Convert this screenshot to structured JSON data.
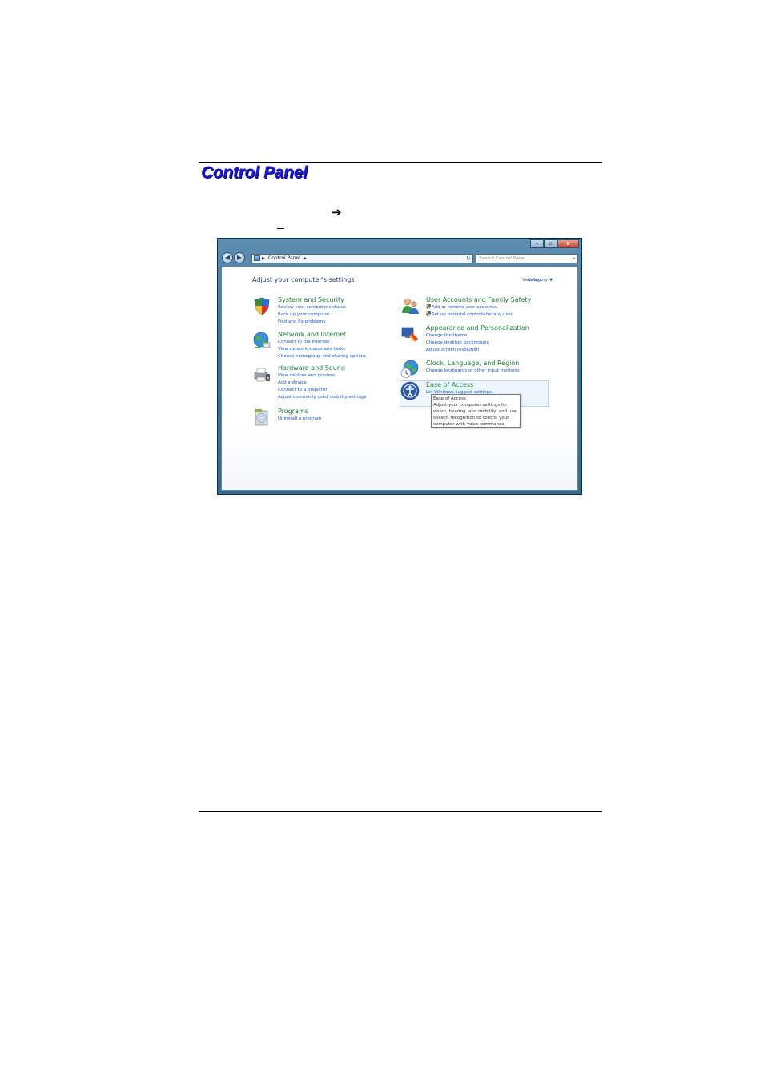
{
  "page": {
    "title": "Control Panel"
  },
  "window": {
    "caption_buttons": {
      "minimize": "–",
      "maximize": "▫",
      "close": "x"
    },
    "nav": {
      "back": "◀",
      "forward": "▶"
    },
    "address": {
      "location": "Control Panel"
    },
    "search": {
      "placeholder": "Search Control Panel"
    }
  },
  "content": {
    "heading": "Adjust your computer's settings",
    "view_by_label": "View by:",
    "view_by_value": "Category"
  },
  "categories": [
    {
      "title": "System and Security",
      "icon": "shield-icon",
      "links": [
        "Review your computer's status",
        "Back up your computer",
        "Find and fix problems"
      ]
    },
    {
      "title": "Network and Internet",
      "icon": "network-globe-icon",
      "links": [
        "Connect to the Internet",
        "View network status and tasks",
        "Choose homegroup and sharing options"
      ]
    },
    {
      "title": "Hardware and Sound",
      "icon": "printer-speaker-icon",
      "links": [
        "View devices and printers",
        "Add a device",
        "Connect to a projector",
        "Adjust commonly used mobility settings"
      ]
    },
    {
      "title": "Programs",
      "icon": "programs-disc-icon",
      "links": [
        "Uninstall a program"
      ]
    },
    {
      "title": "User Accounts and Family Safety",
      "icon": "users-icon",
      "links": [
        "Add or remove user accounts",
        "Set up parental controls for any user"
      ]
    },
    {
      "title": "Appearance and Personalization",
      "icon": "paint-monitor-icon",
      "links": [
        "Change the theme",
        "Change desktop background",
        "Adjust screen resolution"
      ]
    },
    {
      "title": "Clock, Language, and Region",
      "icon": "clock-globe-icon",
      "links": [
        "Change keyboards or other input methods"
      ]
    },
    {
      "title": "Ease of Access",
      "icon": "ease-of-access-icon",
      "links": [
        "Let Windows suggest settings"
      ]
    }
  ],
  "tooltip": {
    "title": "Ease of Access",
    "body": "Adjust your computer settings for vision, hearing, and mobility, and use speech recognition to control your computer with voice commands."
  },
  "colors": {
    "page_title": "#1a1acc",
    "category_title": "#1f7a3a",
    "link": "#1a5bc4",
    "window_frame": "#3f7396"
  }
}
